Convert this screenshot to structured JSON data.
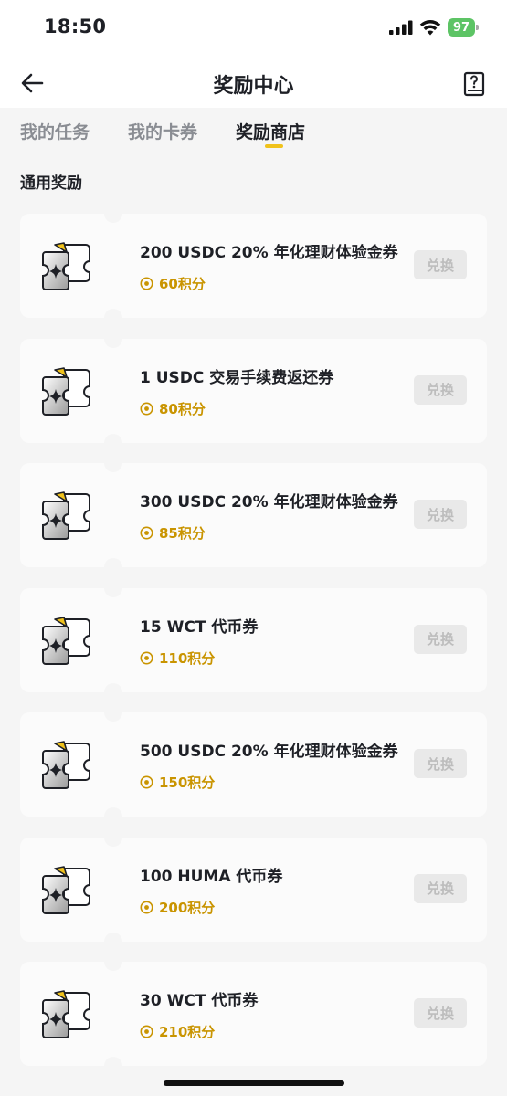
{
  "status_bar": {
    "time": "18:50",
    "battery": "97"
  },
  "header": {
    "title": "奖励中心"
  },
  "tabs": [
    {
      "label": "我的任务"
    },
    {
      "label": "我的卡券"
    },
    {
      "label": "奖励商店"
    }
  ],
  "section": {
    "title": "通用奖励"
  },
  "rewards": [
    {
      "title": "200 USDC 20% 年化理财体验金券",
      "points": "60积分",
      "button": "兑换"
    },
    {
      "title": "1 USDC 交易手续费返还券",
      "points": "80积分",
      "button": "兑换"
    },
    {
      "title": "300 USDC 20% 年化理财体验金券",
      "points": "85积分",
      "button": "兑换"
    },
    {
      "title": "15 WCT 代币券",
      "points": "110积分",
      "button": "兑换"
    },
    {
      "title": "500 USDC 20% 年化理财体验金券",
      "points": "150积分",
      "button": "兑换"
    },
    {
      "title": "100 HUMA 代币券",
      "points": "200积分",
      "button": "兑换"
    },
    {
      "title": "30 WCT 代币券",
      "points": "210积分",
      "button": "兑换"
    }
  ],
  "colors": {
    "accent": "#f0c21b",
    "points": "#c99400",
    "battery": "#5dc465"
  },
  "icons": [
    "back-arrow-icon",
    "help-book-icon",
    "coupon-icon",
    "coin-icon",
    "signal-icon",
    "wifi-icon",
    "battery-icon"
  ]
}
